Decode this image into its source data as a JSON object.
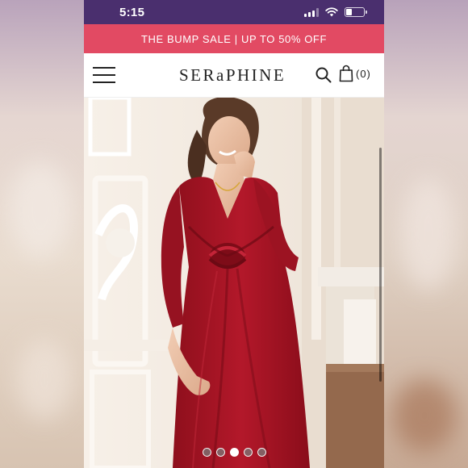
{
  "status_bar": {
    "time": "5:15",
    "battery_level": 0.35
  },
  "promo_banner": {
    "text": "THE BUMP SALE | UP TO 50% OFF"
  },
  "header": {
    "logo": "SERaPHINE",
    "menu_icon": "hamburger-menu-icon",
    "search_icon": "search-icon",
    "bag_icon": "shopping-bag-icon",
    "bag_count": "(0)"
  },
  "hero": {
    "image": "Pregnant woman in a red knot-front dress leaning against a white paneled wall",
    "carousel": {
      "total": 5,
      "active_index": 3
    }
  },
  "colors": {
    "status_bar": "#4a2f6e",
    "promo_banner": "#e24a63",
    "dress": "#a3121f"
  }
}
